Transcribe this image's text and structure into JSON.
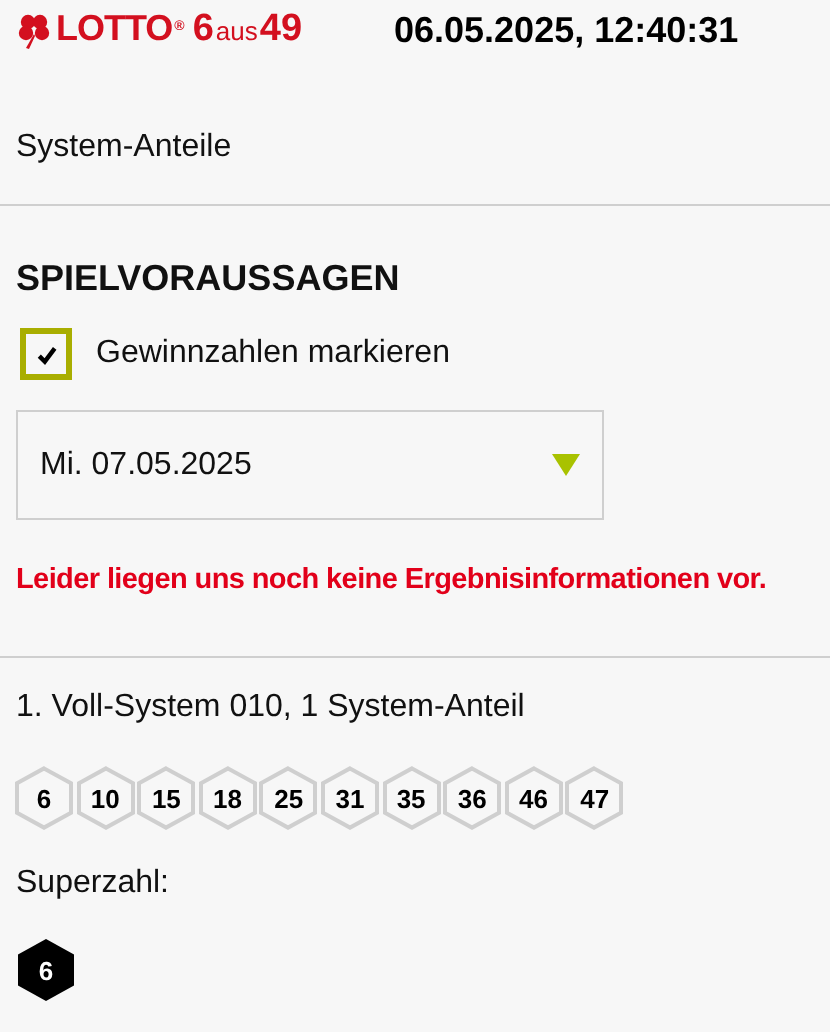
{
  "header": {
    "logo": {
      "word": "LOTTO",
      "registered": "®",
      "six": "6",
      "aus": "aus",
      "fortynine": "49"
    },
    "datetime": "06.05.2025, 12:40:31"
  },
  "section_link": "System-Anteile",
  "heading": "SPIELVORAUSSAGEN",
  "checkbox": {
    "label": "Gewinnzahlen markieren",
    "checked": true
  },
  "date_select": {
    "value": "Mi. 07.05.2025"
  },
  "notice": "Leider liegen uns noch keine Ergebnisinformationen vor.",
  "system": {
    "title": "1. Voll-System 010, 1 System-Anteil",
    "numbers": [
      "6",
      "10",
      "15",
      "18",
      "25",
      "31",
      "35",
      "36",
      "46",
      "47"
    ],
    "superzahl_label": "Superzahl:",
    "superzahl": "6"
  }
}
